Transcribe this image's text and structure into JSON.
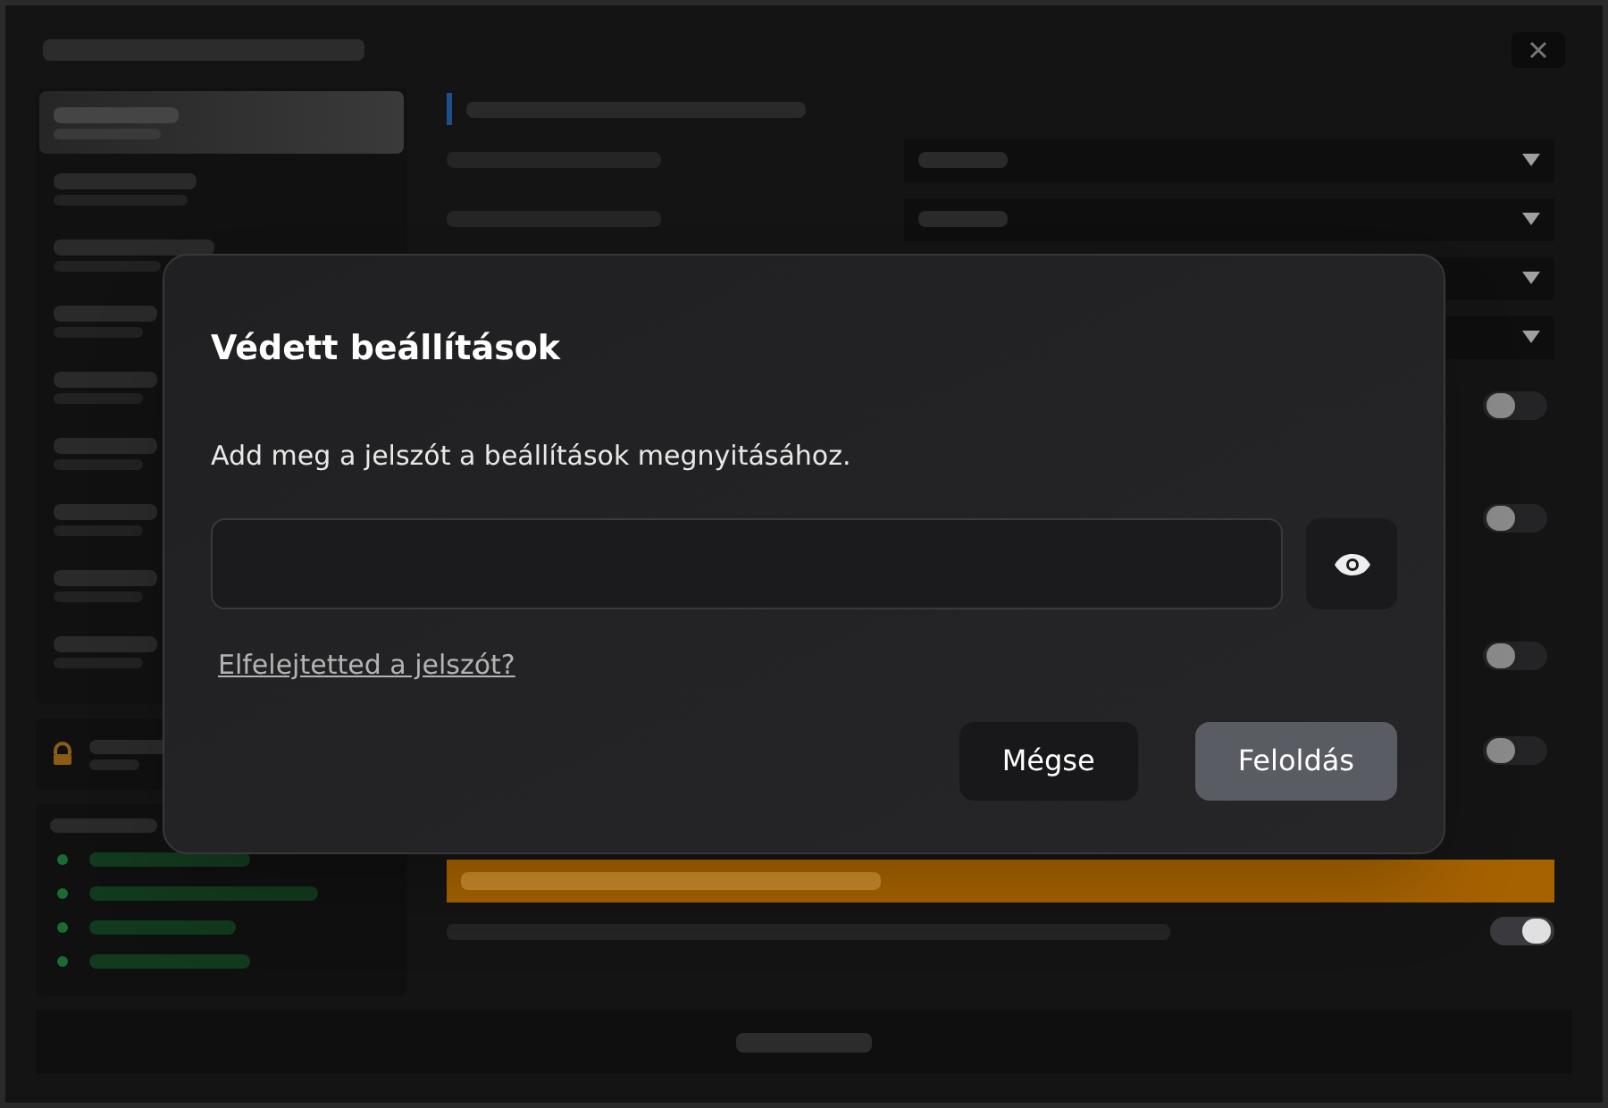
{
  "background": {
    "sidebar_items": [
      {
        "selected": true
      },
      {
        "selected": false
      },
      {
        "selected": false
      },
      {
        "selected": false
      },
      {
        "selected": false
      },
      {
        "selected": false
      },
      {
        "selected": false
      },
      {
        "selected": false
      },
      {
        "selected": false
      }
    ],
    "connections": [
      {
        "color": "#1a6b30"
      },
      {
        "color": "#1a6b30"
      },
      {
        "color": "#1a6b30"
      },
      {
        "color": "#1a6b30"
      }
    ],
    "settings_rows": [
      {
        "kind": "select"
      },
      {
        "kind": "select"
      },
      {
        "kind": "select"
      },
      {
        "kind": "select"
      },
      {
        "kind": "toggle",
        "on": false
      },
      {
        "kind": "toggle",
        "on": false
      },
      {
        "kind": "toggle",
        "on": false
      },
      {
        "kind": "toggle",
        "on": false
      }
    ],
    "news_toggle": {
      "on": true
    }
  },
  "dialog": {
    "title": "Védett beállítások",
    "message": "Add meg a jelszót a beállítások megnyitásához.",
    "forgot_link": "Elfelejtetted a jelszót?",
    "buttons": [
      {
        "label": "Mégse",
        "kind": "secondary"
      },
      {
        "label": "Feloldás",
        "kind": "primary"
      }
    ]
  }
}
